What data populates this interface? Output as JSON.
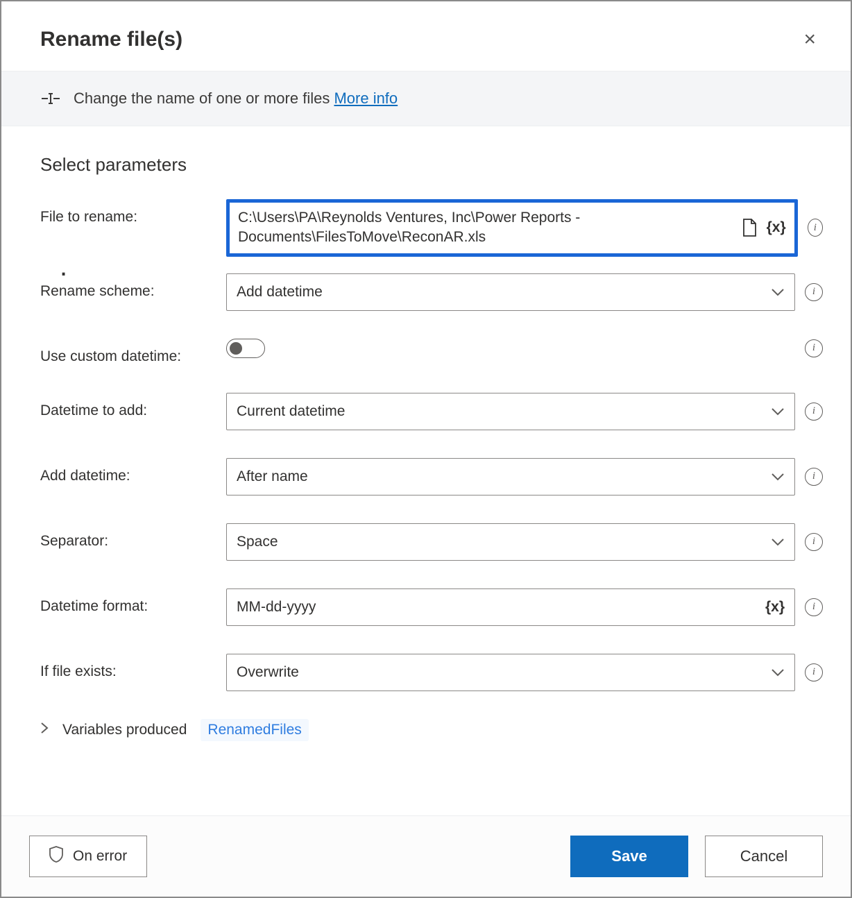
{
  "header": {
    "title": "Rename file(s)",
    "close_label": "×"
  },
  "subheader": {
    "text": "Change the name of one or more files",
    "more_info": "More info"
  },
  "section_title": "Select parameters",
  "fields": {
    "file_to_rename": {
      "label": "File to rename:",
      "value": "C:\\Users\\PA\\Reynolds Ventures, Inc\\Power Reports - Documents\\FilesToMove\\ReconAR.xls"
    },
    "rename_scheme": {
      "label": "Rename scheme:",
      "value": "Add datetime"
    },
    "use_custom_datetime": {
      "label": "Use custom datetime:",
      "on": false
    },
    "datetime_to_add": {
      "label": "Datetime to add:",
      "value": "Current datetime"
    },
    "add_datetime": {
      "label": "Add datetime:",
      "value": "After name"
    },
    "separator": {
      "label": "Separator:",
      "value": "Space"
    },
    "datetime_format": {
      "label": "Datetime format:",
      "value": "MM-dd-yyyy"
    },
    "if_file_exists": {
      "label": "If file exists:",
      "value": "Overwrite"
    }
  },
  "variables": {
    "label": "Variables produced",
    "chip": "RenamedFiles"
  },
  "footer": {
    "on_error": "On error",
    "save": "Save",
    "cancel": "Cancel"
  },
  "icons": {
    "variable_token": "{x}",
    "info_glyph": "i"
  }
}
